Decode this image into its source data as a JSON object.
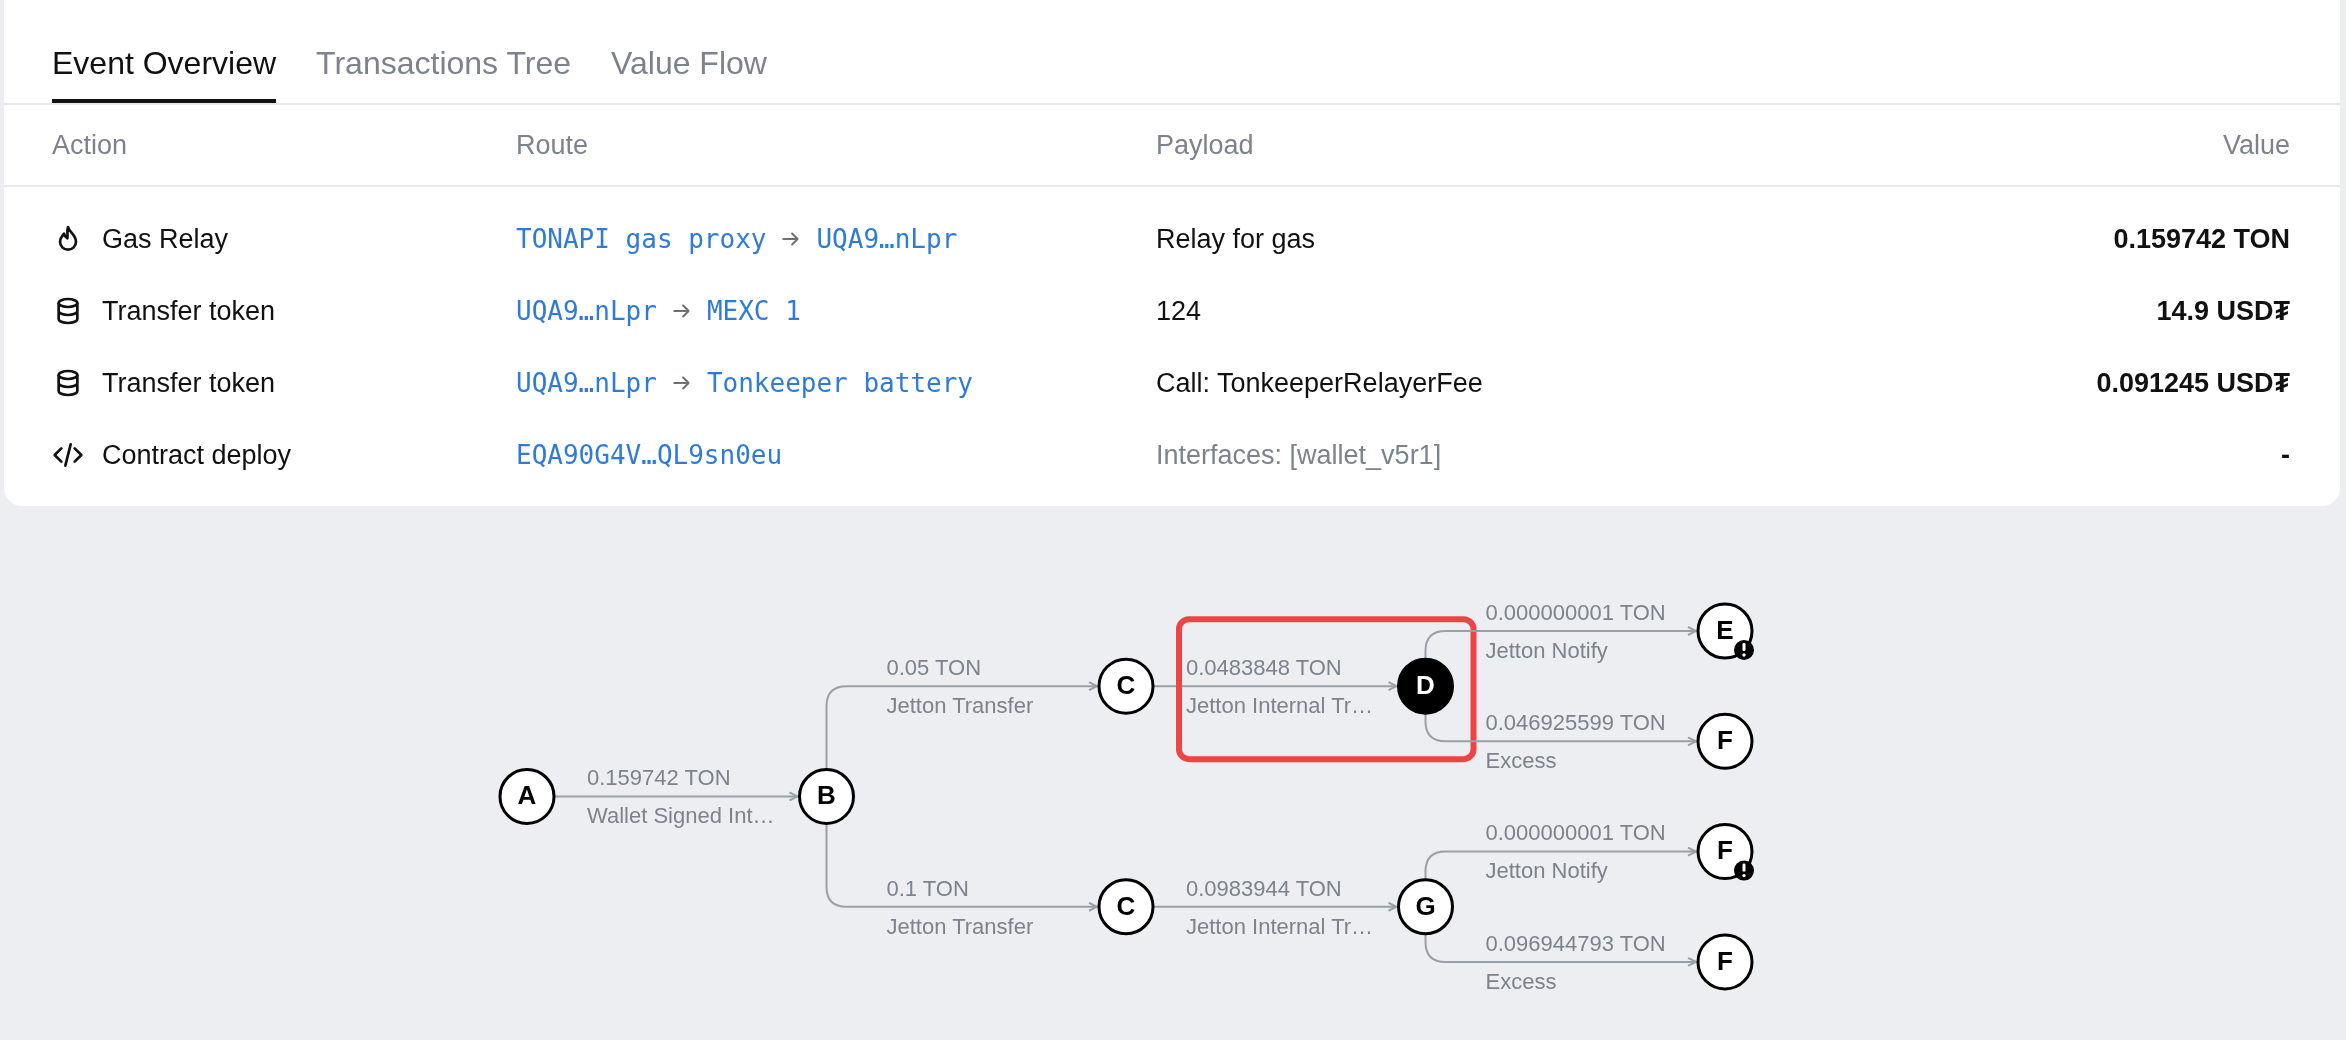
{
  "tabs": [
    {
      "label": "Event Overview",
      "selected": true
    },
    {
      "label": "Transactions Tree",
      "selected": false
    },
    {
      "label": "Value Flow",
      "selected": false
    }
  ],
  "table": {
    "columns": [
      "Action",
      "Route",
      "Payload",
      "Value"
    ],
    "rows": [
      {
        "kind": "gas",
        "action": "Gas Relay",
        "route": {
          "from": "TONAPI gas proxy",
          "to": "UQA9…nLpr"
        },
        "payload": "Relay for gas",
        "payload_muted": false,
        "value": "0.159742 TON"
      },
      {
        "kind": "token",
        "action": "Transfer token",
        "route": {
          "from": "UQA9…nLpr",
          "to": "MEXC 1"
        },
        "payload": "124",
        "payload_muted": false,
        "value": "14.9 USD₮"
      },
      {
        "kind": "token",
        "action": "Transfer token",
        "route": {
          "from": "UQA9…nLpr",
          "to": "Tonkeeper battery"
        },
        "payload": "Call: TonkeeperRelayerFee",
        "payload_muted": false,
        "value": "0.091245 USD₮"
      },
      {
        "kind": "deploy",
        "action": "Contract deploy",
        "route": {
          "from": "EQA90G4V…QL9sn0eu"
        },
        "payload": "Interfaces: [wallet_v5r1]",
        "payload_muted": true,
        "value": "-"
      }
    ]
  },
  "flow": {
    "root": {
      "label": "A",
      "filled": false,
      "warning": false,
      "children": [
        {
          "amount": "0.159742 TON",
          "label": "Wallet Signed Int…",
          "highlighted": false,
          "node": {
            "label": "B",
            "filled": false,
            "warning": false,
            "children": [
              {
                "amount": "0.05 TON",
                "label": "Jetton Transfer",
                "highlighted": false,
                "node": {
                  "label": "C",
                  "filled": false,
                  "warning": false,
                  "children": [
                    {
                      "amount": "0.0483848 TON",
                      "label": "Jetton Internal Tr…",
                      "highlighted": true,
                      "node": {
                        "label": "D",
                        "filled": true,
                        "warning": false,
                        "children": [
                          {
                            "amount": "0.000000001 TON",
                            "label": "Jetton Notify",
                            "highlighted": false,
                            "node": {
                              "label": "E",
                              "filled": false,
                              "warning": true
                            }
                          },
                          {
                            "amount": "0.046925599 TON",
                            "label": "Excess",
                            "highlighted": false,
                            "node": {
                              "label": "F",
                              "filled": false,
                              "warning": false
                            }
                          }
                        ]
                      }
                    }
                  ]
                }
              },
              {
                "amount": "0.1 TON",
                "label": "Jetton Transfer",
                "highlighted": false,
                "node": {
                  "label": "C",
                  "filled": false,
                  "warning": false,
                  "children": [
                    {
                      "amount": "0.0983944 TON",
                      "label": "Jetton Internal Tr…",
                      "highlighted": false,
                      "node": {
                        "label": "G",
                        "filled": false,
                        "warning": false,
                        "children": [
                          {
                            "amount": "0.000000001 TON",
                            "label": "Jetton Notify",
                            "highlighted": false,
                            "node": {
                              "label": "F",
                              "filled": false,
                              "warning": true
                            }
                          },
                          {
                            "amount": "0.096944793 TON",
                            "label": "Excess",
                            "highlighted": false,
                            "node": {
                              "label": "F",
                              "filled": false,
                              "warning": false
                            }
                          }
                        ]
                      }
                    }
                  ]
                }
              }
            ]
          }
        }
      ]
    }
  }
}
